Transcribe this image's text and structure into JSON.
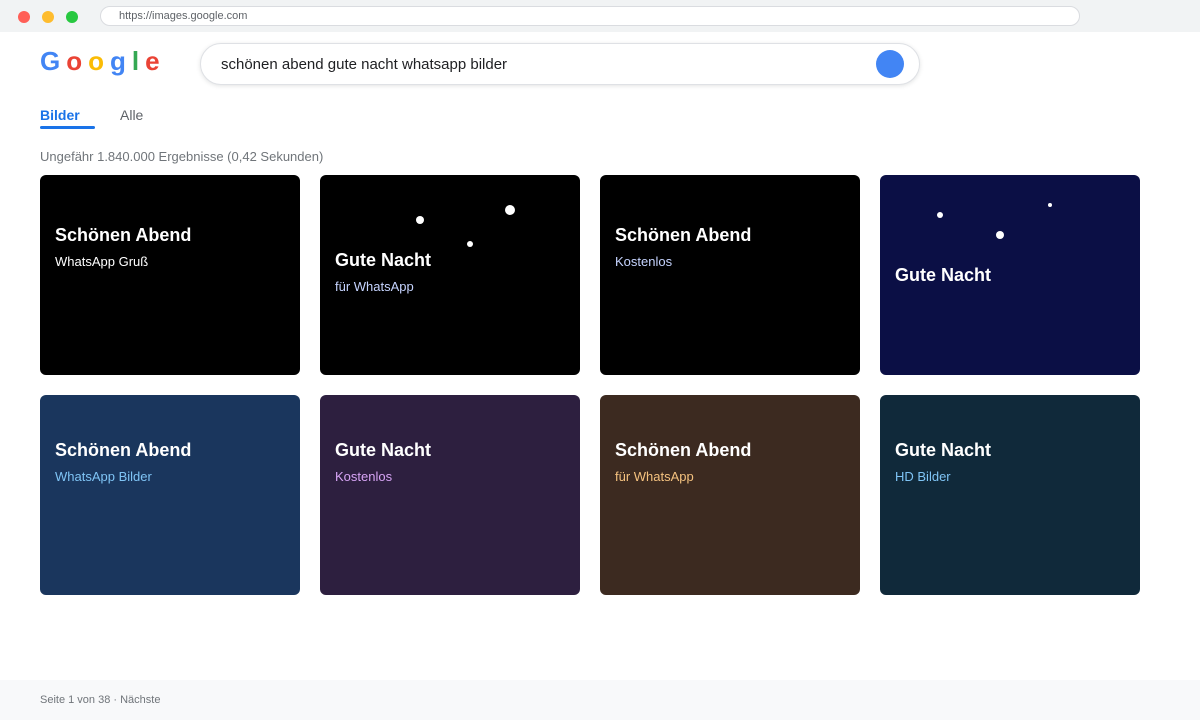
{
  "browser": {
    "url": "https://images.google.com"
  },
  "logo": {
    "letters": [
      {
        "char": "G",
        "color": "#4285f4"
      },
      {
        "char": "o",
        "color": "#ea4335"
      },
      {
        "char": "o",
        "color": "#fbbc05"
      },
      {
        "char": "g",
        "color": "#4285f4"
      },
      {
        "char": "l",
        "color": "#34a853"
      },
      {
        "char": "e",
        "color": "#ea4335"
      }
    ]
  },
  "search": {
    "query": "schönen abend gute nacht whatsapp bilder",
    "button_icon": "search-icon"
  },
  "tabs": [
    {
      "label": "Bilder",
      "active": true
    },
    {
      "label": "Alle",
      "active": false
    }
  ],
  "results_info": "Ungefähr 1.840.000 Ergebnisse (0,42 Sekunden)",
  "cards": [
    {
      "title": "Schönen Abend",
      "subtitle": "WhatsApp Gruß",
      "bg": "#000000",
      "subtitle_color": "#ffffff"
    },
    {
      "title": "Gute Nacht",
      "subtitle": "für WhatsApp",
      "bg": "#000000",
      "subtitle_color": "#c6d4ff"
    },
    {
      "title": "Schönen Abend",
      "subtitle": "Kostenlos",
      "bg": "#000000",
      "subtitle_color": "#c6d4ff"
    },
    {
      "title": "Gute Nacht",
      "subtitle": "",
      "bg": "#0b0f45",
      "subtitle_color": "#ffffff"
    },
    {
      "title": "Schönen Abend",
      "subtitle": "WhatsApp Bilder",
      "bg": "#1a365d",
      "subtitle_color": "#7fc4f5"
    },
    {
      "title": "Gute Nacht",
      "subtitle": "Kostenlos",
      "bg": "#2d1f3f",
      "subtitle_color": "#d7a4f5"
    },
    {
      "title": "Schönen Abend",
      "subtitle": "für WhatsApp",
      "bg": "#3c2a20",
      "subtitle_color": "#f5c27f"
    },
    {
      "title": "Gute Nacht",
      "subtitle": "HD Bilder",
      "bg": "#10293a",
      "subtitle_color": "#7fc4f5"
    }
  ],
  "footer": {
    "text": "Seite 1 von 38 · Nächste"
  }
}
